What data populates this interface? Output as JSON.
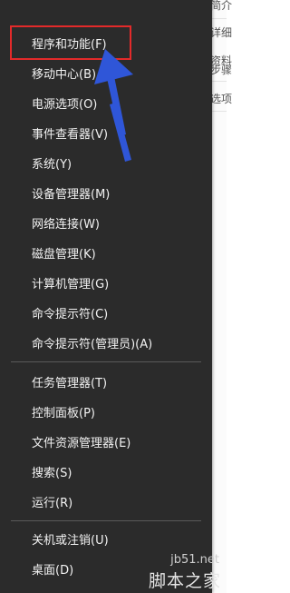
{
  "background": {
    "fragments": [
      "简介",
      "资料",
      "步骤",
      "选项",
      "详细"
    ]
  },
  "menu": {
    "items": [
      {
        "label": "程序和功能(F)"
      },
      {
        "label": "移动中心(B)"
      },
      {
        "label": "电源选项(O)"
      },
      {
        "label": "事件查看器(V)"
      },
      {
        "label": "系统(Y)"
      },
      {
        "label": "设备管理器(M)"
      },
      {
        "label": "网络连接(W)"
      },
      {
        "label": "磁盘管理(K)"
      },
      {
        "label": "计算机管理(G)"
      },
      {
        "label": "命令提示符(C)"
      },
      {
        "label": "命令提示符(管理员)(A)"
      },
      {
        "label": "任务管理器(T)"
      },
      {
        "label": "控制面板(P)"
      },
      {
        "label": "文件资源管理器(E)"
      },
      {
        "label": "搜索(S)"
      },
      {
        "label": "运行(R)"
      },
      {
        "label": "关机或注销(U)"
      },
      {
        "label": "桌面(D)"
      }
    ]
  },
  "watermark": {
    "url": "jb51.net",
    "brand": "脚本之家"
  },
  "colors": {
    "menu_bg": "#2b2b2b",
    "menu_text": "#f2f2f2",
    "highlight_border": "#e32a2a",
    "arrow": "#2f56d8"
  },
  "annotation": {
    "icon": "arrow-up-left-icon"
  }
}
